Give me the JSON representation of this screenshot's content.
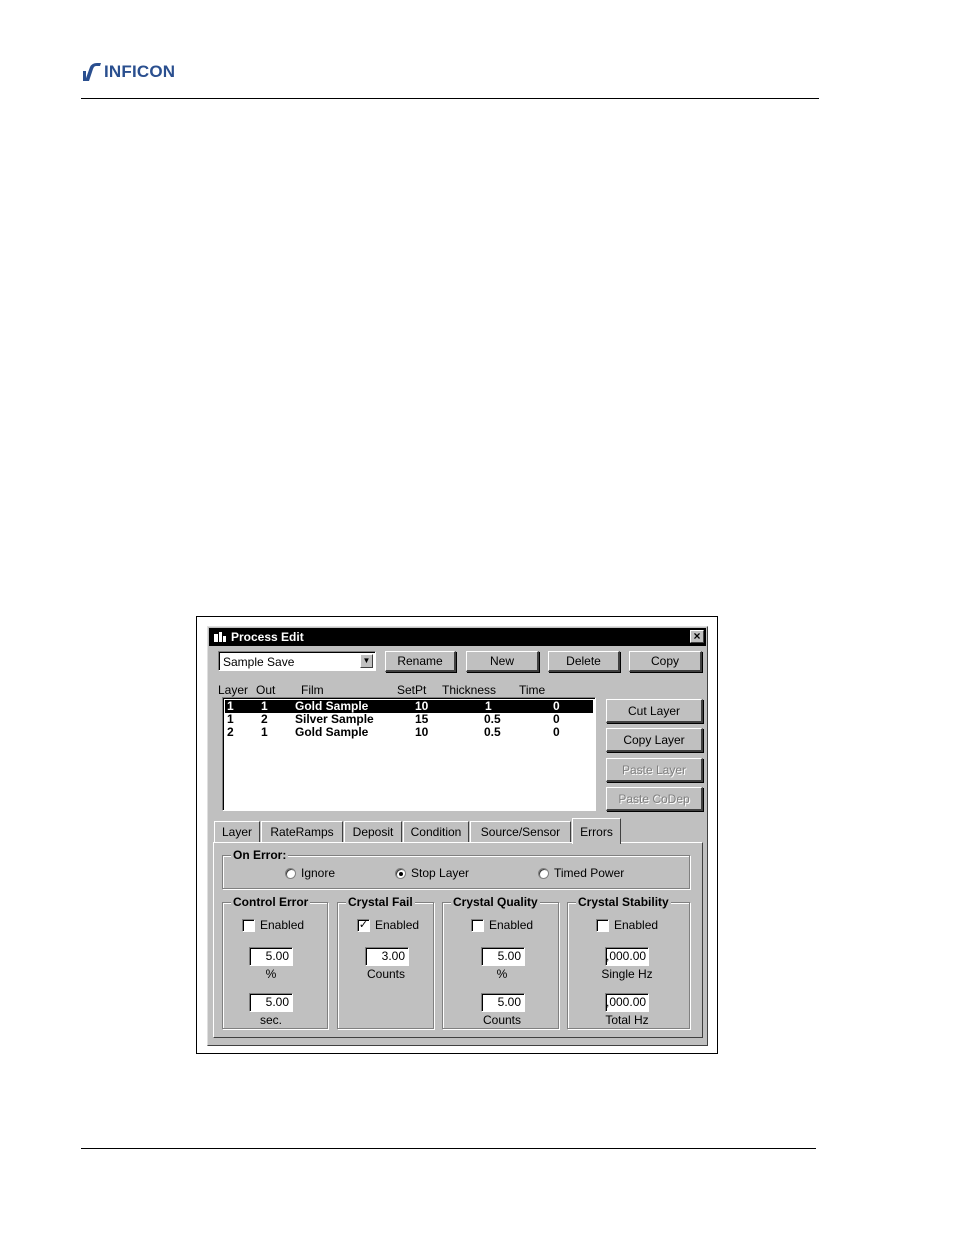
{
  "brand": {
    "name": "INFICON"
  },
  "window": {
    "title": "Process Edit",
    "close_glyph": "×"
  },
  "toolbar": {
    "process_value": "Sample Save",
    "rename_label": "Rename",
    "new_label": "New",
    "delete_label": "Delete",
    "copy_label": "Copy"
  },
  "layers": {
    "columns": [
      "Layer",
      "Out",
      "Film",
      "SetPt",
      "Thickness",
      "Time"
    ],
    "rows": [
      {
        "layer": "1",
        "out": "1",
        "film": "Gold Sample",
        "setpt": "10",
        "thickness": "1",
        "time": "0",
        "selected": true
      },
      {
        "layer": "1",
        "out": "2",
        "film": "Silver Sample",
        "setpt": "15",
        "thickness": "0.5",
        "time": "0",
        "selected": false
      },
      {
        "layer": "2",
        "out": "1",
        "film": "Gold Sample",
        "setpt": "10",
        "thickness": "0.5",
        "time": "0",
        "selected": false
      }
    ]
  },
  "side_buttons": {
    "cut_layer": "Cut Layer",
    "copy_layer": "Copy Layer",
    "paste_layer": "Paste Layer",
    "paste_codep": "Paste CoDep"
  },
  "tabs": [
    {
      "label": "Layer"
    },
    {
      "label": "RateRamps"
    },
    {
      "label": "Deposit"
    },
    {
      "label": "Condition"
    },
    {
      "label": "Source/Sensor"
    },
    {
      "label": "Errors"
    }
  ],
  "on_error": {
    "title": "On Error:",
    "options": [
      "Ignore",
      "Stop Layer",
      "Timed Power"
    ],
    "selected": "Stop Layer"
  },
  "groups": {
    "control_error": {
      "title": "Control Error",
      "enabled_label": "Enabled",
      "enabled": false,
      "field1": "5.00",
      "unit1": "%",
      "field2": "5.00",
      "unit2": "sec."
    },
    "crystal_fail": {
      "title": "Crystal Fail",
      "enabled_label": "Enabled",
      "enabled": true,
      "field1": "3.00",
      "unit1": "Counts"
    },
    "crystal_quality": {
      "title": "Crystal Quality",
      "enabled_label": "Enabled",
      "enabled": false,
      "field1": "5.00",
      "unit1": "%",
      "field2": "5.00",
      "unit2": "Counts"
    },
    "crystal_stability": {
      "title": "Crystal Stability",
      "enabled_label": "Enabled",
      "enabled": false,
      "field1": ",000.00",
      "unit1": "Single Hz",
      "field2": ",000.00",
      "unit2": "Total Hz"
    }
  },
  "check_glyph": "✓",
  "combo_arrow_glyph": "▼"
}
